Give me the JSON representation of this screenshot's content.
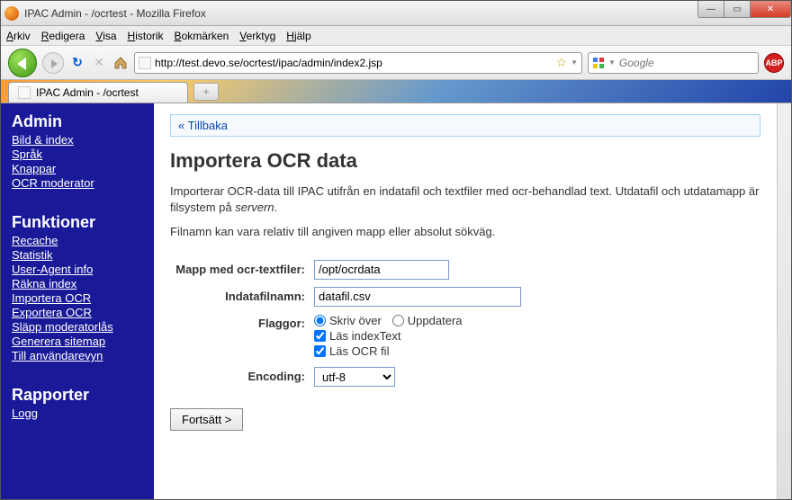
{
  "window": {
    "title": "IPAC Admin - /ocrtest - Mozilla Firefox"
  },
  "menubar": [
    "Arkiv",
    "Redigera",
    "Visa",
    "Historik",
    "Bokmärken",
    "Verktyg",
    "Hjälp"
  ],
  "toolbar": {
    "url": "http://test.devo.se/ocrtest/ipac/admin/index2.jsp",
    "search_placeholder": "Google",
    "abp": "ABP"
  },
  "tab": {
    "title": "IPAC Admin - /ocrtest",
    "newtab": "+"
  },
  "sidebar": {
    "sections": [
      {
        "title": "Admin",
        "items": [
          "Bild & index",
          "Språk",
          "Knappar",
          "OCR moderator"
        ]
      },
      {
        "title": "Funktioner",
        "items": [
          "Recache",
          "Statistik",
          "User-Agent info",
          "Räkna index",
          "Importera OCR",
          "Exportera OCR",
          "Släpp moderatorlås",
          "Generera sitemap",
          "Till användarevyn"
        ]
      },
      {
        "title": "Rapporter",
        "items": [
          "Logg"
        ]
      }
    ]
  },
  "main": {
    "back": "« Tillbaka",
    "h1": "Importera OCR data",
    "p1a": "Importerar OCR-data till IPAC utifrån en indatafil och textfiler med ocr-behandlad text. Utdatafil och utdatamapp är filsystem på ",
    "p1em": "servern",
    "p1b": ".",
    "p2": "Filnamn kan vara relativ till angiven mapp eller absolut sökväg.",
    "form": {
      "dir_label": "Mapp med ocr-textfiler:",
      "dir_value": "/opt/ocrdata",
      "file_label": "Indatafilnamn:",
      "file_value": "datafil.csv",
      "flags_label": "Flaggor:",
      "radio_overwrite": "Skriv över",
      "radio_update": "Uppdatera",
      "check_indextext": "Läs indexText",
      "check_ocrfile": "Läs OCR fil",
      "encoding_label": "Encoding:",
      "encoding_value": "utf-8",
      "submit": "Fortsätt >"
    }
  }
}
